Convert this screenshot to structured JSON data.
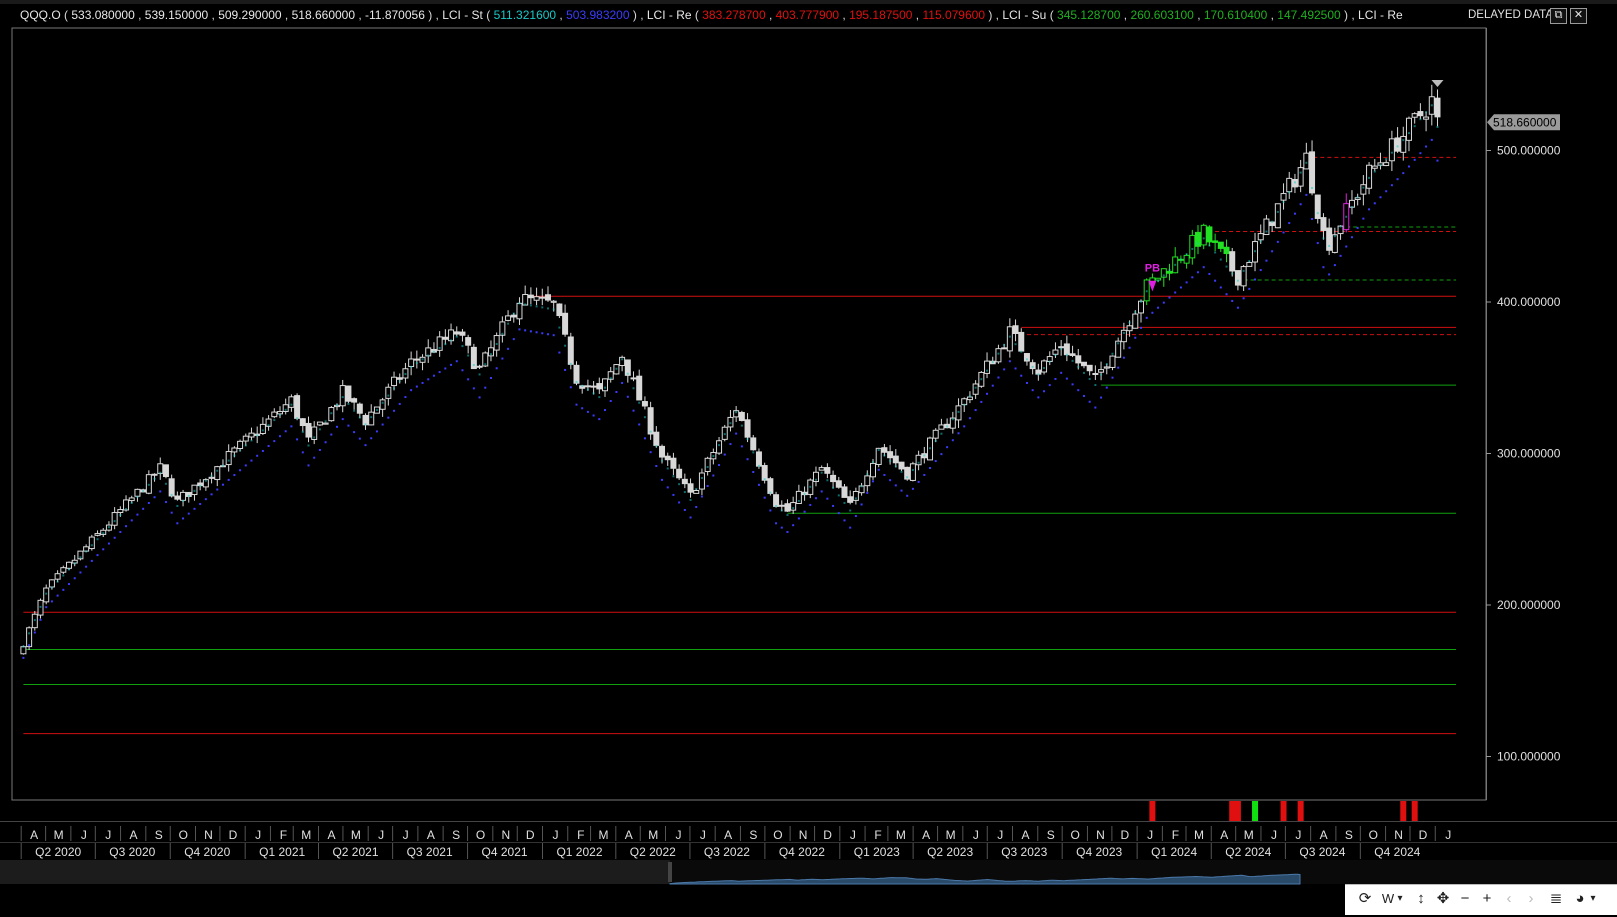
{
  "header": {
    "symbol": "QQQ.O",
    "ohlc": [
      "533.080000",
      "539.150000",
      "509.290000",
      "518.660000",
      "-11.870056"
    ],
    "indicators": [
      {
        "name": "LCI - St",
        "values": [
          {
            "v": "511.321600",
            "color": "#19c8c8"
          },
          {
            "v": "503.983200",
            "color": "#3b3bff"
          }
        ]
      },
      {
        "name": "LCI - Re",
        "values": [
          {
            "v": "383.278700",
            "color": "#e01010"
          },
          {
            "v": "403.777900",
            "color": "#e01010"
          },
          {
            "v": "195.187500",
            "color": "#e01010"
          },
          {
            "v": "115.079600",
            "color": "#e01010"
          }
        ]
      },
      {
        "name": "LCI - Su",
        "values": [
          {
            "v": "345.128700",
            "color": "#20b020"
          },
          {
            "v": "260.603100",
            "color": "#20b020"
          },
          {
            "v": "170.610400",
            "color": "#20b020"
          },
          {
            "v": "147.492500",
            "color": "#20b020"
          }
        ]
      },
      {
        "name": "LCI - Re",
        "values": []
      }
    ],
    "delayed": "DELAYED DATA",
    "restore_glyph": "⧉",
    "close_glyph": "✕"
  },
  "chart_data": {
    "type": "candlestick",
    "timeframe": "W",
    "last_price_label": "518.660000",
    "y_ticks": [
      {
        "v": 100,
        "label": "100.000000"
      },
      {
        "v": 200,
        "label": "200.000000"
      },
      {
        "v": 300,
        "label": "300.000000"
      },
      {
        "v": 400,
        "label": "400.000000"
      },
      {
        "v": 500,
        "label": "500.000000"
      }
    ],
    "ylim": [
      63,
      518.66
    ],
    "anchors": [
      {
        "d": "2020-03-20",
        "v": 175
      },
      {
        "d": "2020-04-17",
        "v": 210
      },
      {
        "d": "2020-06-05",
        "v": 238
      },
      {
        "d": "2020-09-04",
        "v": 290
      },
      {
        "d": "2020-09-25",
        "v": 268
      },
      {
        "d": "2021-01-08",
        "v": 318
      },
      {
        "d": "2021-02-12",
        "v": 335
      },
      {
        "d": "2021-03-05",
        "v": 308
      },
      {
        "d": "2021-04-16",
        "v": 340
      },
      {
        "d": "2021-05-14",
        "v": 322
      },
      {
        "d": "2021-07-09",
        "v": 360
      },
      {
        "d": "2021-09-03",
        "v": 380
      },
      {
        "d": "2021-10-01",
        "v": 355
      },
      {
        "d": "2021-11-19",
        "v": 402
      },
      {
        "d": "2021-12-31",
        "v": 398
      },
      {
        "d": "2022-01-28",
        "v": 350
      },
      {
        "d": "2022-02-25",
        "v": 340
      },
      {
        "d": "2022-03-25",
        "v": 365
      },
      {
        "d": "2022-05-13",
        "v": 298
      },
      {
        "d": "2022-06-17",
        "v": 272
      },
      {
        "d": "2022-08-12",
        "v": 330
      },
      {
        "d": "2022-09-30",
        "v": 268
      },
      {
        "d": "2022-10-14",
        "v": 262
      },
      {
        "d": "2022-11-25",
        "v": 290
      },
      {
        "d": "2022-12-30",
        "v": 265
      },
      {
        "d": "2023-02-03",
        "v": 305
      },
      {
        "d": "2023-03-10",
        "v": 287
      },
      {
        "d": "2023-05-19",
        "v": 335
      },
      {
        "d": "2023-07-14",
        "v": 380
      },
      {
        "d": "2023-08-18",
        "v": 355
      },
      {
        "d": "2023-09-15",
        "v": 372
      },
      {
        "d": "2023-10-27",
        "v": 348
      },
      {
        "d": "2023-12-29",
        "v": 410
      },
      {
        "d": "2024-03-08",
        "v": 445
      },
      {
        "d": "2024-04-19",
        "v": 417
      },
      {
        "d": "2024-07-12",
        "v": 495
      },
      {
        "d": "2024-08-02",
        "v": 445
      },
      {
        "d": "2024-08-09",
        "v": 440
      },
      {
        "d": "2024-09-27",
        "v": 485
      },
      {
        "d": "2024-11-08",
        "v": 510
      },
      {
        "d": "2024-12-13",
        "v": 533
      },
      {
        "d": "2024-12-20",
        "v": 518.66
      }
    ],
    "levels": [
      {
        "v": 403.78,
        "color": "#d01010",
        "style": "solid",
        "from": "2021-12-03"
      },
      {
        "v": 383.28,
        "color": "#d01010",
        "style": "solid",
        "from": "2023-07-28"
      },
      {
        "v": 378.5,
        "color": "#d01010",
        "style": "dashed",
        "from": "2023-08-04"
      },
      {
        "v": 345.13,
        "color": "#10a010",
        "style": "solid",
        "from": "2023-11-03"
      },
      {
        "v": 260.6,
        "color": "#10a010",
        "style": "solid",
        "from": "2022-10-14"
      },
      {
        "v": 195.19,
        "color": "#d01010",
        "style": "solid",
        "from": "2020-03-20"
      },
      {
        "v": 170.61,
        "color": "#10a010",
        "style": "solid",
        "from": "2020-03-20"
      },
      {
        "v": 147.49,
        "color": "#10a010",
        "style": "solid",
        "from": "2020-03-20"
      },
      {
        "v": 115.08,
        "color": "#d01010",
        "style": "solid",
        "from": "2020-03-20"
      },
      {
        "v": 495.5,
        "color": "#d01010",
        "style": "dashed",
        "from": "2024-07-12"
      },
      {
        "v": 446.5,
        "color": "#d01010",
        "style": "dashed",
        "from": "2024-03-22"
      },
      {
        "v": 449.5,
        "color": "#10a010",
        "style": "dashed",
        "from": "2024-08-30"
      },
      {
        "v": 414.5,
        "color": "#10a010",
        "style": "dashed",
        "from": "2024-04-26"
      }
    ],
    "green_candle_range": [
      "2023-12-29",
      "2024-04-05"
    ],
    "magenta_candle": "2024-08-30",
    "pb_marker": {
      "d": "2024-01-05",
      "label": "PB"
    },
    "signals": [
      {
        "d": "2024-01-05",
        "color": "#e01010"
      },
      {
        "d": "2024-04-12",
        "color": "#e01010"
      },
      {
        "d": "2024-04-19",
        "color": "#e01010"
      },
      {
        "d": "2024-05-10",
        "color": "#10e010"
      },
      {
        "d": "2024-06-14",
        "color": "#e01010"
      },
      {
        "d": "2024-07-05",
        "color": "#e01010"
      },
      {
        "d": "2024-11-08",
        "color": "#e01010"
      },
      {
        "d": "2024-11-22",
        "color": "#e01010"
      }
    ],
    "months": [
      {
        "d": "2020-04-01",
        "label": "A"
      },
      {
        "d": "2020-05-01",
        "label": "M"
      },
      {
        "d": "2020-06-01",
        "label": "J"
      },
      {
        "d": "2020-07-01",
        "label": "J"
      },
      {
        "d": "2020-08-01",
        "label": "A"
      },
      {
        "d": "2020-09-01",
        "label": "S"
      },
      {
        "d": "2020-10-01",
        "label": "O"
      },
      {
        "d": "2020-11-01",
        "label": "N"
      },
      {
        "d": "2020-12-01",
        "label": "D"
      },
      {
        "d": "2021-01-01",
        "label": "J"
      },
      {
        "d": "2021-02-01",
        "label": "F"
      },
      {
        "d": "2021-03-01",
        "label": "M"
      },
      {
        "d": "2021-04-01",
        "label": "A"
      },
      {
        "d": "2021-05-01",
        "label": "M"
      },
      {
        "d": "2021-06-01",
        "label": "J"
      },
      {
        "d": "2021-07-01",
        "label": "J"
      },
      {
        "d": "2021-08-01",
        "label": "A"
      },
      {
        "d": "2021-09-01",
        "label": "S"
      },
      {
        "d": "2021-10-01",
        "label": "O"
      },
      {
        "d": "2021-11-01",
        "label": "N"
      },
      {
        "d": "2021-12-01",
        "label": "D"
      },
      {
        "d": "2022-01-01",
        "label": "J"
      },
      {
        "d": "2022-02-01",
        "label": "F"
      },
      {
        "d": "2022-03-01",
        "label": "M"
      },
      {
        "d": "2022-04-01",
        "label": "A"
      },
      {
        "d": "2022-05-01",
        "label": "M"
      },
      {
        "d": "2022-06-01",
        "label": "J"
      },
      {
        "d": "2022-07-01",
        "label": "J"
      },
      {
        "d": "2022-08-01",
        "label": "A"
      },
      {
        "d": "2022-09-01",
        "label": "S"
      },
      {
        "d": "2022-10-01",
        "label": "O"
      },
      {
        "d": "2022-11-01",
        "label": "N"
      },
      {
        "d": "2022-12-01",
        "label": "D"
      },
      {
        "d": "2023-01-01",
        "label": "J"
      },
      {
        "d": "2023-02-01",
        "label": "F"
      },
      {
        "d": "2023-03-01",
        "label": "M"
      },
      {
        "d": "2023-04-01",
        "label": "A"
      },
      {
        "d": "2023-05-01",
        "label": "M"
      },
      {
        "d": "2023-06-01",
        "label": "J"
      },
      {
        "d": "2023-07-01",
        "label": "J"
      },
      {
        "d": "2023-08-01",
        "label": "A"
      },
      {
        "d": "2023-09-01",
        "label": "S"
      },
      {
        "d": "2023-10-01",
        "label": "O"
      },
      {
        "d": "2023-11-01",
        "label": "N"
      },
      {
        "d": "2023-12-01",
        "label": "D"
      },
      {
        "d": "2024-01-01",
        "label": "J"
      },
      {
        "d": "2024-02-01",
        "label": "F"
      },
      {
        "d": "2024-03-01",
        "label": "M"
      },
      {
        "d": "2024-04-01",
        "label": "A"
      },
      {
        "d": "2024-05-01",
        "label": "M"
      },
      {
        "d": "2024-06-01",
        "label": "J"
      },
      {
        "d": "2024-07-01",
        "label": "J"
      },
      {
        "d": "2024-08-01",
        "label": "A"
      },
      {
        "d": "2024-09-01",
        "label": "S"
      },
      {
        "d": "2024-10-01",
        "label": "O"
      },
      {
        "d": "2024-11-01",
        "label": "N"
      },
      {
        "d": "2024-12-01",
        "label": "D"
      },
      {
        "d": "2025-01-01",
        "label": "J"
      }
    ],
    "quarters": [
      {
        "d": "2020-04-01",
        "label": "Q2 2020"
      },
      {
        "d": "2020-07-01",
        "label": "Q3 2020"
      },
      {
        "d": "2020-10-01",
        "label": "Q4 2020"
      },
      {
        "d": "2021-01-01",
        "label": "Q1 2021"
      },
      {
        "d": "2021-04-01",
        "label": "Q2 2021"
      },
      {
        "d": "2021-07-01",
        "label": "Q3 2021"
      },
      {
        "d": "2021-10-01",
        "label": "Q4 2021"
      },
      {
        "d": "2022-01-01",
        "label": "Q1 2022"
      },
      {
        "d": "2022-04-01",
        "label": "Q2 2022"
      },
      {
        "d": "2022-07-01",
        "label": "Q3 2022"
      },
      {
        "d": "2022-10-01",
        "label": "Q4 2022"
      },
      {
        "d": "2023-01-01",
        "label": "Q1 2023"
      },
      {
        "d": "2023-04-01",
        "label": "Q2 2023"
      },
      {
        "d": "2023-07-01",
        "label": "Q3 2023"
      },
      {
        "d": "2023-10-01",
        "label": "Q4 2023"
      },
      {
        "d": "2024-01-01",
        "label": "Q1 2024"
      },
      {
        "d": "2024-04-01",
        "label": "Q2 2024"
      },
      {
        "d": "2024-07-01",
        "label": "Q3 2024"
      },
      {
        "d": "2024-10-01",
        "label": "Q4 2024"
      }
    ]
  },
  "toolbar": {
    "refresh": "⟳",
    "timeframe": "W",
    "timeframe_caret": "▾",
    "vresize": "↕",
    "pan": "✥",
    "zoom_out": "−",
    "zoom_in": "+",
    "prev": "‹",
    "next": "›",
    "menu": "≣",
    "palette": "◕",
    "palette_caret": "▾"
  }
}
